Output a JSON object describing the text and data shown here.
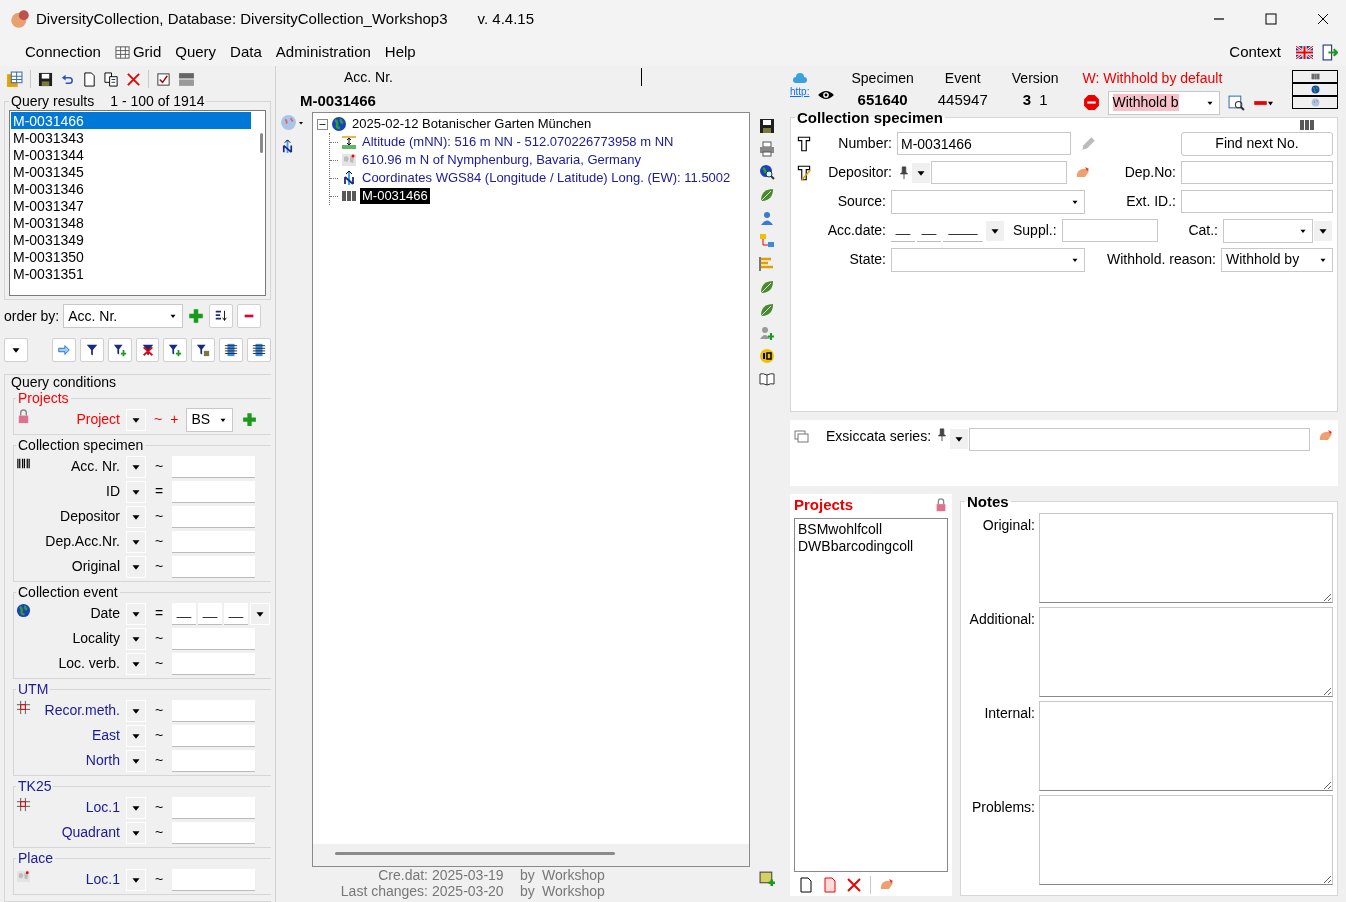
{
  "window": {
    "title": "DiversityCollection,  Database: DiversityCollection_Workshop3",
    "version": "v. 4.4.15"
  },
  "menu": {
    "items": [
      {
        "label": "Connection",
        "kind": "plain"
      },
      {
        "label": "Grid",
        "kind": "icon"
      },
      {
        "label": "Query",
        "kind": "plain"
      },
      {
        "label": "Data",
        "kind": "plain"
      },
      {
        "label": "Administration",
        "kind": "plain"
      },
      {
        "label": "Help",
        "kind": "plain"
      }
    ],
    "context": "Context"
  },
  "query_results": {
    "title": "Query results",
    "range": "1 - 100 of 1914",
    "items": [
      {
        "label": "M-0031466",
        "selected": true
      },
      {
        "label": "M-0031343",
        "selected": false
      },
      {
        "label": "M-0031344",
        "selected": false
      },
      {
        "label": "M-0031345",
        "selected": false
      },
      {
        "label": "M-0031346",
        "selected": false
      },
      {
        "label": "M-0031347",
        "selected": false
      },
      {
        "label": "M-0031348",
        "selected": false
      },
      {
        "label": "M-0031349",
        "selected": false
      },
      {
        "label": "M-0031350",
        "selected": false
      },
      {
        "label": "M-0031351",
        "selected": false
      }
    ]
  },
  "order_by": {
    "label": "order by:",
    "value": "Acc. Nr."
  },
  "query_conditions": {
    "title": "Query conditions",
    "groups": [
      {
        "title": "Projects",
        "color": "#ff0000",
        "rows": [
          {
            "label": "Project",
            "kind": "project",
            "operator": "~",
            "plus": "+",
            "value": "BS"
          }
        ]
      },
      {
        "title": "Collection specimen",
        "color": "#000000",
        "rows": [
          {
            "label": "Acc. Nr.",
            "kind": "text",
            "operator": "~"
          },
          {
            "label": "ID",
            "kind": "text",
            "operator": "="
          },
          {
            "label": "Depositor",
            "kind": "text",
            "operator": "~"
          },
          {
            "label": "Dep.Acc.Nr.",
            "kind": "text",
            "operator": "~"
          },
          {
            "label": "Original",
            "kind": "text",
            "operator": "~"
          }
        ]
      },
      {
        "title": "Collection event",
        "color": "#000000",
        "rows": [
          {
            "label": "Date",
            "kind": "date",
            "operator": "=",
            "parts": [
              "__",
              "__",
              "__"
            ]
          },
          {
            "label": "Locality",
            "kind": "text",
            "operator": "~"
          },
          {
            "label": "Loc. verb.",
            "kind": "text",
            "operator": "~"
          }
        ]
      },
      {
        "title": "UTM",
        "color": "#1a1a9a",
        "rows": [
          {
            "label": "Recor.meth.",
            "kind": "text",
            "operator": "~"
          },
          {
            "label": "East",
            "kind": "text",
            "operator": "~"
          },
          {
            "label": "North",
            "kind": "text",
            "operator": "~"
          }
        ]
      },
      {
        "title": "TK25",
        "color": "#1a1a9a",
        "rows": [
          {
            "label": "Loc.1",
            "kind": "text",
            "operator": "~"
          },
          {
            "label": "Quadrant",
            "kind": "text",
            "operator": "~"
          }
        ]
      },
      {
        "title": "Place",
        "color": "#1a1a9a",
        "rows": [
          {
            "label": "Loc.1",
            "kind": "text",
            "operator": "~"
          }
        ]
      }
    ]
  },
  "detail": {
    "column_label": "Acc. Nr.",
    "accession": "M-0031466"
  },
  "tree": {
    "nodes": [
      {
        "label": "2025-02-12 Botanischer Garten München",
        "kind": "event",
        "expanded": true,
        "selected": false,
        "children": [
          {
            "label": "Altitude (mNN): 516 m NN - 512.070226773958 m NN",
            "kind": "altitude",
            "selected": false
          },
          {
            "label": "610.96 m N of  Nymphenburg, Bavaria, Germany",
            "kind": "locality",
            "selected": false
          },
          {
            "label": "Coordinates WGS84 (Longitude / Latitude) Long. (EW): 11.5002",
            "kind": "coordinates",
            "selected": false
          },
          {
            "label": "M-0031466",
            "kind": "specimen",
            "selected": true
          }
        ]
      }
    ]
  },
  "record": {
    "created_label": "Cre.dat:",
    "created": "2025-03-19",
    "created_by_label": "by",
    "created_by": "Workshop",
    "changed_label": "Last changes:",
    "changed": "2025-03-20",
    "changed_by_label": "by",
    "changed_by": "Workshop"
  },
  "header": {
    "link": "http:",
    "columns": [
      {
        "heading": "Specimen",
        "value": "651640"
      },
      {
        "heading": "Event",
        "value": "445947"
      },
      {
        "heading": "Version",
        "value": "3",
        "value_2": "1"
      }
    ],
    "warning": "W: Withhold by default",
    "withhold": "Withhold b"
  },
  "specimen": {
    "title": "Collection specimen",
    "number_label": "Number:",
    "number": "M-0031466",
    "find_button": "Find next No.",
    "depositor_label": "Depositor:",
    "dep_no_label": "Dep.No:",
    "source_label": "Source:",
    "ext_id_label": "Ext. ID.:",
    "acc_date_label": "Acc.date:",
    "acc_date": [
      "__",
      "__",
      "____"
    ],
    "suppl_label": "Suppl.:",
    "cat_label": "Cat.:",
    "state_label": "State:",
    "withhold_reason_label": "Withhold. reason:",
    "withhold_reason": "Withhold by"
  },
  "exsiccata": {
    "label": "Exsiccata series:"
  },
  "projects": {
    "title": "Projects",
    "items": [
      "BSMwohlfcoll",
      "DWBbarcodingcoll"
    ]
  },
  "notes": {
    "title": "Notes",
    "fields": [
      {
        "label": "Original:"
      },
      {
        "label": "Additional:"
      },
      {
        "label": "Internal:"
      },
      {
        "label": "Problems:"
      }
    ]
  }
}
